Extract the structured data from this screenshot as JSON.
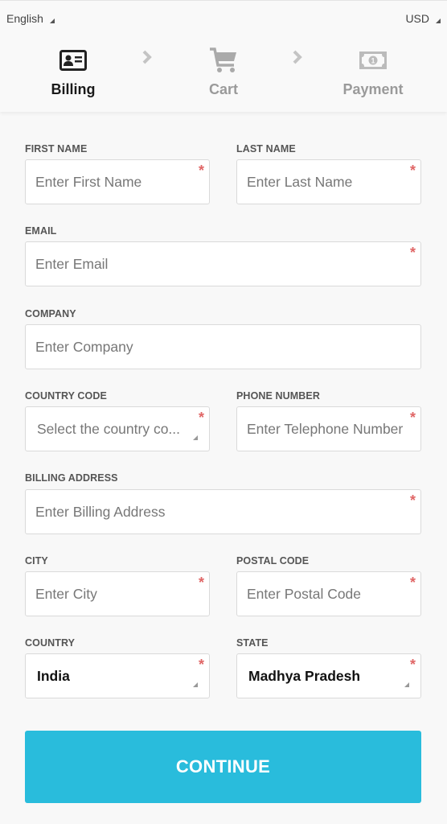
{
  "header": {
    "language": "English",
    "currency": "USD",
    "steps": [
      {
        "label": "Billing",
        "icon": "id-card-icon",
        "active": true
      },
      {
        "label": "Cart",
        "icon": "cart-icon",
        "active": false
      },
      {
        "label": "Payment",
        "icon": "money-bill-icon",
        "active": false
      }
    ]
  },
  "form": {
    "first_name": {
      "label": "FIRST NAME",
      "placeholder": "Enter First Name",
      "required": "*"
    },
    "last_name": {
      "label": "LAST NAME",
      "placeholder": "Enter Last Name",
      "required": "*"
    },
    "email": {
      "label": "EMAIL",
      "placeholder": "Enter Email",
      "required": "*"
    },
    "company": {
      "label": "COMPANY",
      "placeholder": "Enter Company"
    },
    "country_code": {
      "label": "COUNTRY CODE",
      "value": "Select the country co...",
      "required": "*"
    },
    "phone": {
      "label": "PHONE NUMBER",
      "placeholder": "Enter Telephone Number",
      "required": "*"
    },
    "billing_address": {
      "label": "BILLING ADDRESS",
      "placeholder": "Enter Billing Address",
      "required": "*"
    },
    "city": {
      "label": "CITY",
      "placeholder": "Enter City",
      "required": "*"
    },
    "postal_code": {
      "label": "POSTAL CODE",
      "placeholder": "Enter Postal Code",
      "required": "*"
    },
    "country": {
      "label": "COUNTRY",
      "value": "India",
      "required": "*"
    },
    "state": {
      "label": "STATE",
      "value": "Madhya Pradesh",
      "required": "*"
    }
  },
  "continue_label": "CONTINUE",
  "colors": {
    "accent": "#29bcdc",
    "required": "#e06666",
    "active_step": "#1a1a1a",
    "inactive_step": "#9a9a9a"
  }
}
